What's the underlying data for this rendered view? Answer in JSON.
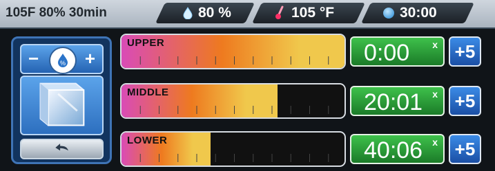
{
  "status": {
    "preset": "105F 80% 30min",
    "humidity": "80 %",
    "temperature": "105 °F",
    "timer": "30:00"
  },
  "controls": {
    "minus_label": "−",
    "plus_label": "+"
  },
  "zones": [
    {
      "label": "UPPER",
      "time": "0:00",
      "clear": "x",
      "add": "+5",
      "progress": 1.0
    },
    {
      "label": "MIDDLE",
      "time": "20:01",
      "clear": "x",
      "add": "+5",
      "progress": 0.7
    },
    {
      "label": "LOWER",
      "time": "40:06",
      "clear": "x",
      "add": "+5",
      "progress": 0.4
    }
  ],
  "colors": {
    "panel_blue": "#3f74b6",
    "timer_green": "#2ea13a",
    "add_blue": "#2a6fcc",
    "bar_yellow": "#f0c84c",
    "bar_orange": "#ee7a1f",
    "bar_magenta": "#d94bb7"
  }
}
